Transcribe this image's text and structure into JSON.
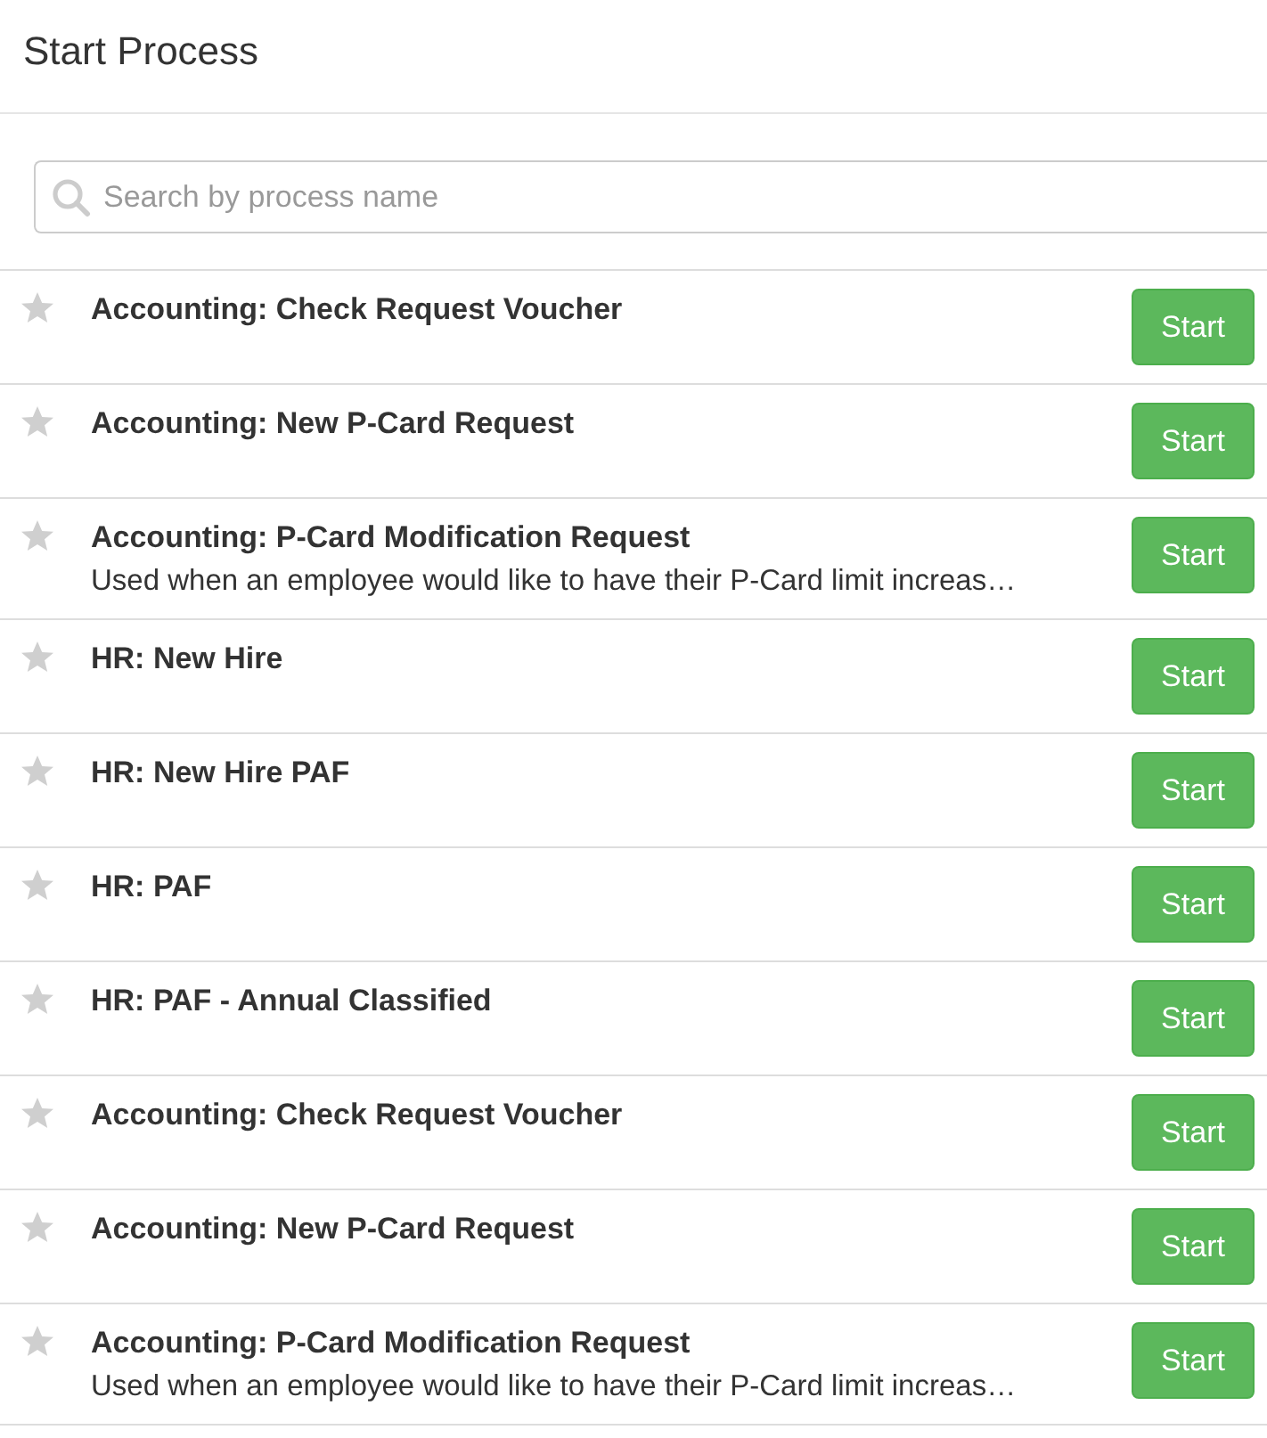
{
  "title": "Start Process",
  "search": {
    "placeholder": "Search by process name"
  },
  "processes": [
    {
      "name": "Accounting: Check Request Voucher",
      "starred": false,
      "button": "Start"
    },
    {
      "name": "Accounting: New P-Card Request",
      "starred": false,
      "button": "Start"
    },
    {
      "name": "Accounting: P-Card Modification Request",
      "description": "Used when an employee would like to have their P-Card limit increas…",
      "starred": false,
      "button": "Start"
    },
    {
      "name": "HR: New Hire",
      "starred": false,
      "button": "Start"
    },
    {
      "name": "HR: New Hire PAF",
      "starred": false,
      "button": "Start"
    },
    {
      "name": "HR: PAF",
      "starred": false,
      "button": "Start"
    },
    {
      "name": "HR: PAF - Annual Classified",
      "starred": false,
      "button": "Start"
    },
    {
      "name": "Accounting: Check Request Voucher",
      "starred": false,
      "button": "Start"
    },
    {
      "name": "Accounting: New P-Card Request",
      "starred": false,
      "button": "Start"
    },
    {
      "name": "Accounting: P-Card Modification Request",
      "description": "Used when an employee would like to have their P-Card limit increas…",
      "starred": false,
      "button": "Start"
    }
  ]
}
